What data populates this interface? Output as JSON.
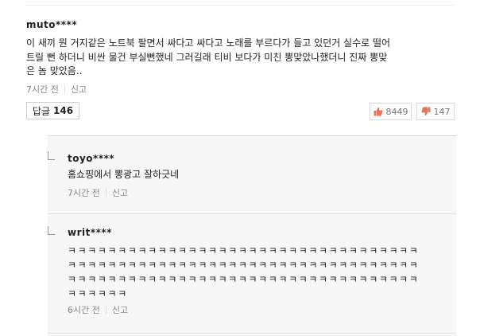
{
  "comment": {
    "username": "muto****",
    "text_lines": [
      "이 새끼 뭔 거지같은 노트북 팔면서 싸다고 싸다고 노래를 부르다가 들고 있던거 실수로 떨어",
      "트릴 뻔 하더니 비싼 물건 부실뻔했네 그러길래 티비 보다가 미친 뽕맞았나했더니 진짜 뽕맞",
      "은 놈 맞았음.."
    ],
    "time": "7시간 전",
    "report_label": "신고",
    "reply_label": "답글",
    "reply_count": "146",
    "like_count": "8449",
    "dislike_count": "147"
  },
  "replies": [
    {
      "username": "toyo****",
      "text_lines": [
        "홈쇼핑에서 뽕광고 잘하긋네"
      ],
      "time": "7시간 전",
      "report_label": "신고"
    },
    {
      "username": "writ****",
      "text_lines": [
        "ㅋㅋㅋㅋㅋㅋㅋㅋㅋㅋㅋㅋㅋㅋㅋㅋㅋㅋㅋㅋㅋㅋㅋㅋㅋㅋㅋㅋㅋㅋㅋㅋㅋㅋㅋ",
        "ㅋㅋㅋㅋㅋㅋㅋㅋㅋㅋㅋㅋㅋㅋㅋㅋㅋㅋㅋㅋㅋㅋㅋㅋㅋㅋㅋㅋㅋㅋㅋㅋㅋㅋㅋ",
        "ㅋㅋㅋㅋㅋㅋㅋㅋㅋㅋㅋㅋㅋㅋㅋㅋㅋㅋㅋㅋㅋㅋㅋㅋㅋㅋㅋㅋㅋㅋㅋㅋㅋㅋㅋ",
        "ㅋㅋㅋㅋㅋㅋ"
      ],
      "time": "6시간 전",
      "report_label": "신고"
    }
  ],
  "icons": {
    "like": "thumbs-up-icon",
    "dislike": "thumbs-down-icon",
    "reply_marker": "reply-elbow-icon"
  },
  "colors": {
    "like_icon": "#e8775a",
    "dislike_icon": "#e8775a",
    "panel_bg": "#f7f7f7"
  }
}
